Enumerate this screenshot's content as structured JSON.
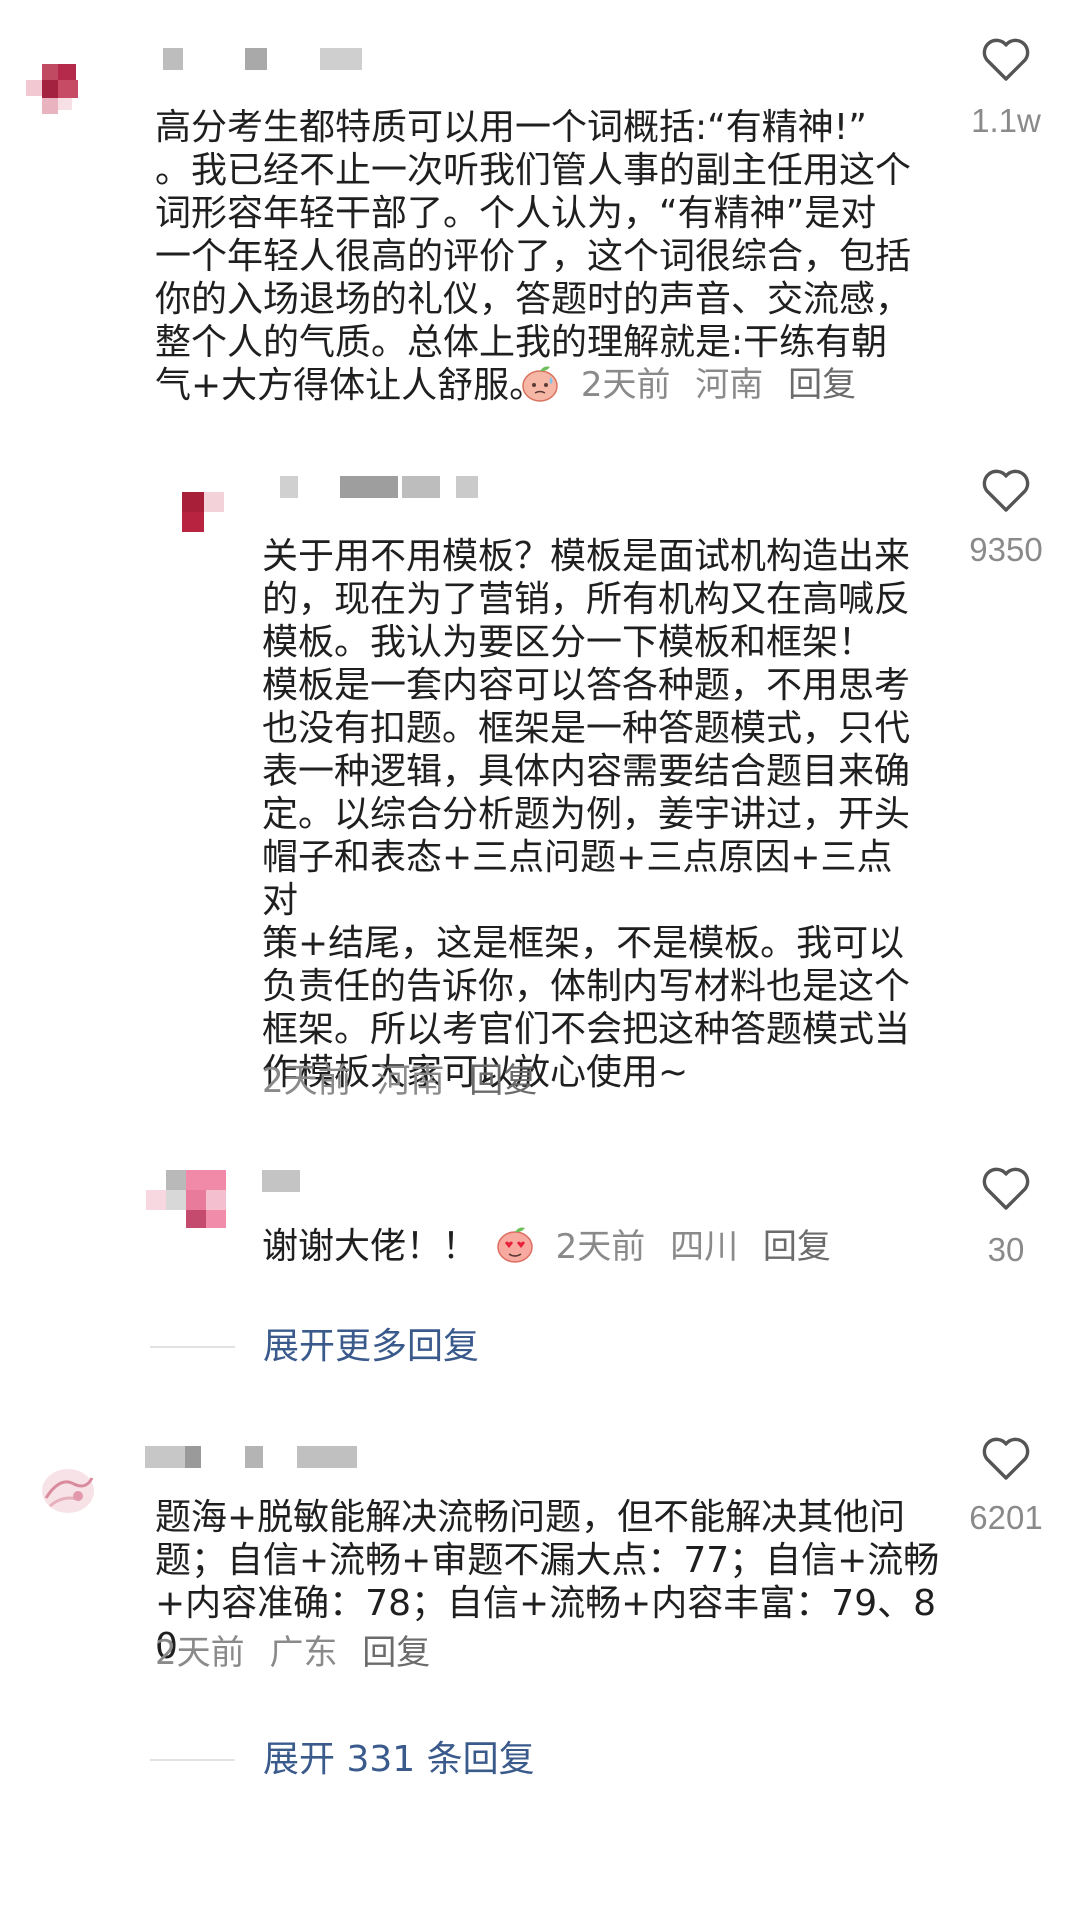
{
  "comments": [
    {
      "body": "高分考生都特质可以用一个词概括:“有精神!”\n。我已经不止一次听我们管人事的副主任用这个\n词形容年轻干部了。个人认为，“有精神”是对\n一个年轻人很高的评价了，这个词很综合，包括\n你的入场退场的礼仪，答题时的声音、交流感，\n整个人的气质。总体上我的理解就是:干练有朝\n气+大方得体让人舒服。",
      "emoji": "peach-sweat-emoji",
      "time": "2天前",
      "location": "河南",
      "reply_label": "回复",
      "likes": "1.1w",
      "replies": [
        {
          "body": "关于用不用模板？模板是面试机构造出来\n的，现在为了营销，所有机构又在高喊反\n模板。我认为要区分一下模板和框架！\n模板是一套内容可以答各种题，不用思考\n也没有扣题。框架是一种答题模式，只代\n表一种逻辑，具体内容需要结合题目来确\n定。以综合分析题为例，姜宇讲过，开头\n帽子和表态+三点问题+三点原因+三点对\n策+结尾，这是框架，不是模板。我可以\n负责任的告诉你，体制内写材料也是这个\n框架。所以考官们不会把这种答题模式当\n作模板大家可以放心使用~",
          "time": "2天前",
          "location": "河南",
          "reply_label": "回复",
          "likes": "9350"
        },
        {
          "body": "谢谢大佬！！",
          "emoji": "heart-eyes-emoji",
          "time": "2天前",
          "location": "四川",
          "reply_label": "回复",
          "likes": "30"
        }
      ],
      "expand_label": "展开更多回复"
    },
    {
      "body": "题海+脱敏能解决流畅问题，但不能解决其他问\n题；自信+流畅+审题不漏大点：77；自信+流畅\n+内容准确：78；自信+流畅+内容丰富：79、80",
      "time": "2天前",
      "location": "广东",
      "reply_label": "回复",
      "likes": "6201",
      "expand_label": "展开 331 条回复"
    }
  ],
  "colors": {
    "text": "#1f1f1f",
    "meta": "#8a8a8a",
    "link": "#3a5a8c",
    "heart_stroke": "#555555"
  }
}
